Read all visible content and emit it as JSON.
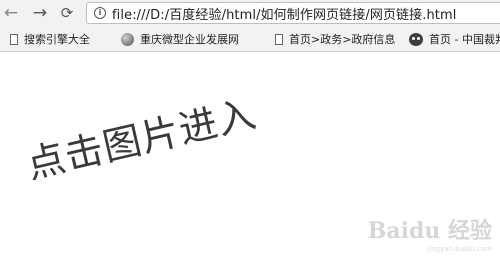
{
  "nav": {
    "back_icon": "arrow-left-icon",
    "forward_icon": "arrow-right-icon",
    "reload_icon": "reload-icon"
  },
  "omnibox": {
    "info_icon": "info-icon",
    "url": "file:///D:/百度经验/html/如何制作网页链接/网页链接.html"
  },
  "bookmarks": [
    {
      "icon": "page-icon",
      "label": "搜索引擎大全"
    },
    {
      "icon": "globe-icon",
      "label": "重庆微型企业发展网"
    },
    {
      "icon": "page-icon",
      "label": "首页>政务>政府信息"
    },
    {
      "icon": "cat-icon",
      "label": "首页 - 中国裁判文书网"
    }
  ],
  "page": {
    "link_text": "点击图片进入"
  },
  "watermark": {
    "logo": "Baidu 经验",
    "sub": "jingyan.baidu.com"
  },
  "colors": {
    "toolbar_bg": "#f2f2f2",
    "page_bg": "#ffffff",
    "link_text": "#3a3a3a"
  }
}
